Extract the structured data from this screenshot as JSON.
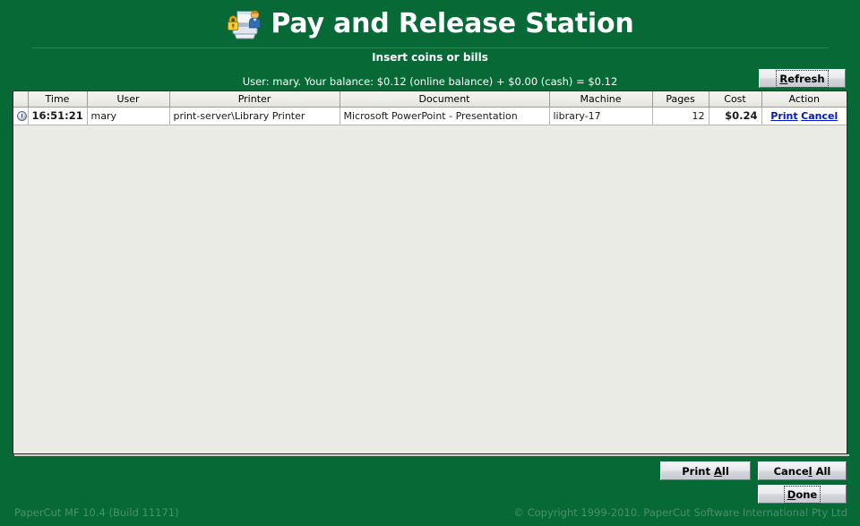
{
  "app": {
    "title": "Pay and Release Station",
    "icon": "printer-lock-user-icon",
    "subtitle": "Insert coins or bills",
    "balance_line": "User: mary. Your balance: $0.12 (online balance)  +  $0.00 (cash)  =  $0.12",
    "background_color": "#066936",
    "panel_color": "#ebebe6",
    "link_color": "#0016cc"
  },
  "buttons": {
    "refresh": {
      "label": "Refresh",
      "mnemonic": "R",
      "focused": true
    },
    "print_all": {
      "label": "Print All",
      "mnemonic": "A",
      "focused": false
    },
    "cancel_all": {
      "label": "Cancel All",
      "mnemonic": "l",
      "focused": false
    },
    "done": {
      "label": "Done",
      "mnemonic": "D",
      "focused": true
    }
  },
  "table": {
    "columns": [
      "",
      "Time",
      "User",
      "Printer",
      "Document",
      "Machine",
      "Pages",
      "Cost",
      "Action"
    ],
    "rows": [
      {
        "icon": "job-status-icon",
        "time": "16:51:21",
        "user": "mary",
        "printer": "print-server\\Library Printer",
        "document": "Microsoft PowerPoint - Presentation",
        "machine": "library-17",
        "pages": "12",
        "cost": "$0.24",
        "action_print": "Print",
        "action_cancel": "Cancel"
      }
    ]
  },
  "footer": {
    "left": "PaperCut MF 10.4 (Build 11171)",
    "right": "© Copyright 1999-2010. PaperCut Software International Pty Ltd"
  }
}
